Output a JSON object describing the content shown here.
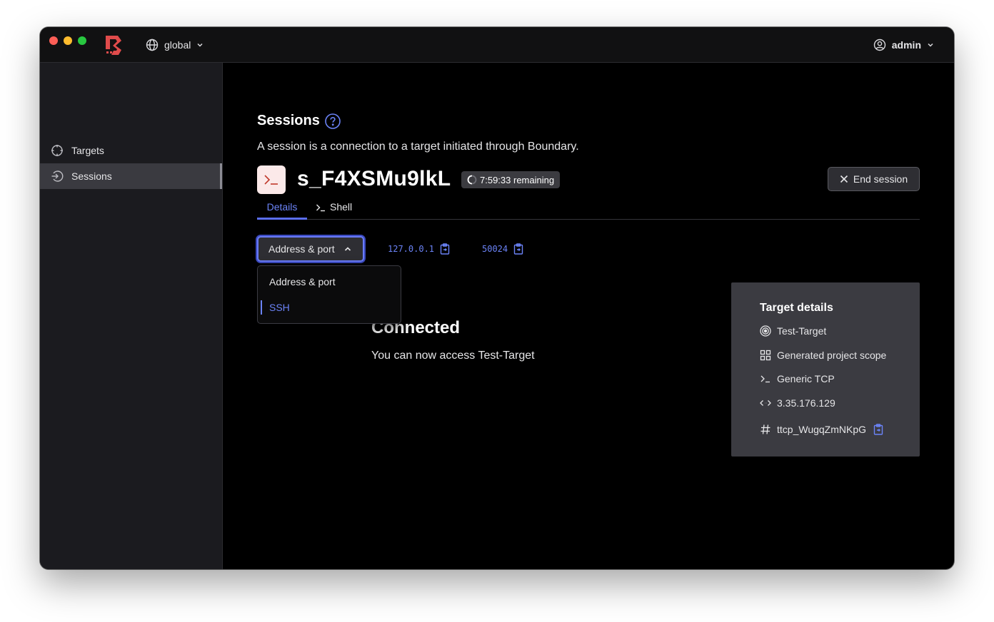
{
  "header": {
    "scope_label": "global",
    "user_label": "admin"
  },
  "sidebar": {
    "items": [
      {
        "label": "Targets",
        "icon": "crosshair-icon"
      },
      {
        "label": "Sessions",
        "icon": "sign-in-icon",
        "active": true
      }
    ]
  },
  "page": {
    "title": "Sessions",
    "subtitle": "A session is a connection to a target initiated through Boundary."
  },
  "session": {
    "id": "s_F4XSMu9lkL",
    "remaining": "7:59:33 remaining",
    "end_button": "End session"
  },
  "tabs": [
    {
      "label": "Details",
      "active": true
    },
    {
      "label": "Shell",
      "active": false
    }
  ],
  "connection": {
    "dropdown_label": "Address & port",
    "address": "127.0.0.1",
    "port": "50024",
    "menu_options": [
      "Address & port",
      "SSH"
    ],
    "menu_highlighted": "SSH",
    "status_title": "Connected",
    "status_message": "You can now access Test-Target"
  },
  "target_details": {
    "title": "Target details",
    "name": "Test-Target",
    "scope": "Generated project scope",
    "type": "Generic TCP",
    "address": "3.35.176.129",
    "id": "ttcp_WugqZmNKpG"
  },
  "colors": {
    "accent": "#6b83f7",
    "brand": "#e04b4b",
    "background": "#000000",
    "sidebar": "#1b1b1f"
  }
}
